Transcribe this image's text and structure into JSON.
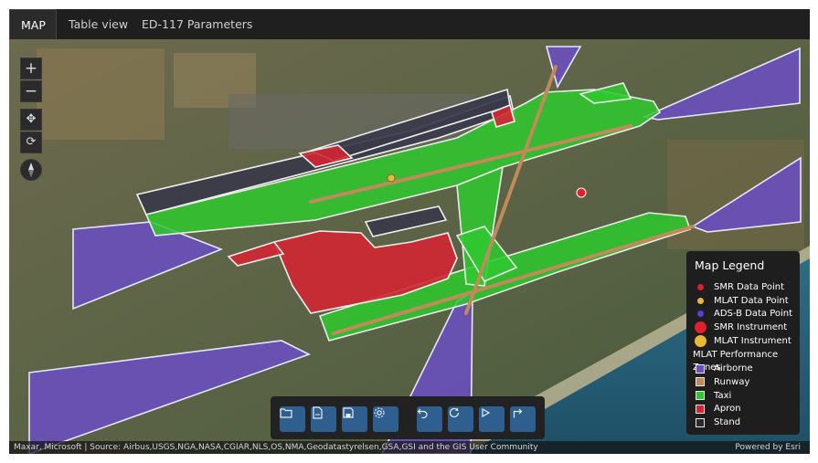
{
  "tabs": [
    "MAP",
    "Table view",
    "ED-117 Parameters"
  ],
  "zoom_controls": {
    "zoom_in": "+",
    "zoom_out": "−"
  },
  "map_tools": [
    "pan-icon",
    "rotate-icon",
    "compass-icon"
  ],
  "legend": {
    "title": "Map Legend",
    "points": [
      {
        "label": "SMR Data Point",
        "color": "#e0202a",
        "kind": "small-dot"
      },
      {
        "label": "MLAT Data Point",
        "color": "#e8b83a",
        "kind": "small-dot"
      },
      {
        "label": "ADS-B Data Point",
        "color": "#5a3fd6",
        "kind": "small-dot"
      },
      {
        "label": "SMR Instrument",
        "color": "#e0202a",
        "kind": "large-dot"
      },
      {
        "label": "MLAT Instrument",
        "color": "#e8b83a",
        "kind": "large-dot"
      }
    ],
    "zones_title": "MLAT Performance Zones",
    "zones": [
      {
        "label": "Airborne",
        "color": "#6a4fc0"
      },
      {
        "label": "Runway",
        "color": "#c08a5a"
      },
      {
        "label": "Taxi",
        "color": "#2ec82e"
      },
      {
        "label": "Apron",
        "color": "#d22632"
      },
      {
        "label": "Stand",
        "color": "#3a3a4a"
      }
    ]
  },
  "toolbar": {
    "buttons": [
      "folder-icon",
      "csv-file-icon",
      "save-icon",
      "settings-icon",
      "undo-icon",
      "restart-icon",
      "play-icon",
      "redo-icon"
    ]
  },
  "attribution": {
    "source": "Maxar, Microsoft | Source: Airbus,USGS,NGA,NASA,CGIAR,NLS,OS,NMA,Geodatastyrelsen,GSA,GSI and the GIS User Community",
    "powered_by": "Powered by Esri"
  },
  "colors": {
    "airborne": "#6a4fc0",
    "runway": "#c08a5a",
    "taxi": "#2ec82e",
    "apron": "#d22632",
    "stand": "#3a3a4a",
    "toolbar_button": "#2f5f8f"
  }
}
